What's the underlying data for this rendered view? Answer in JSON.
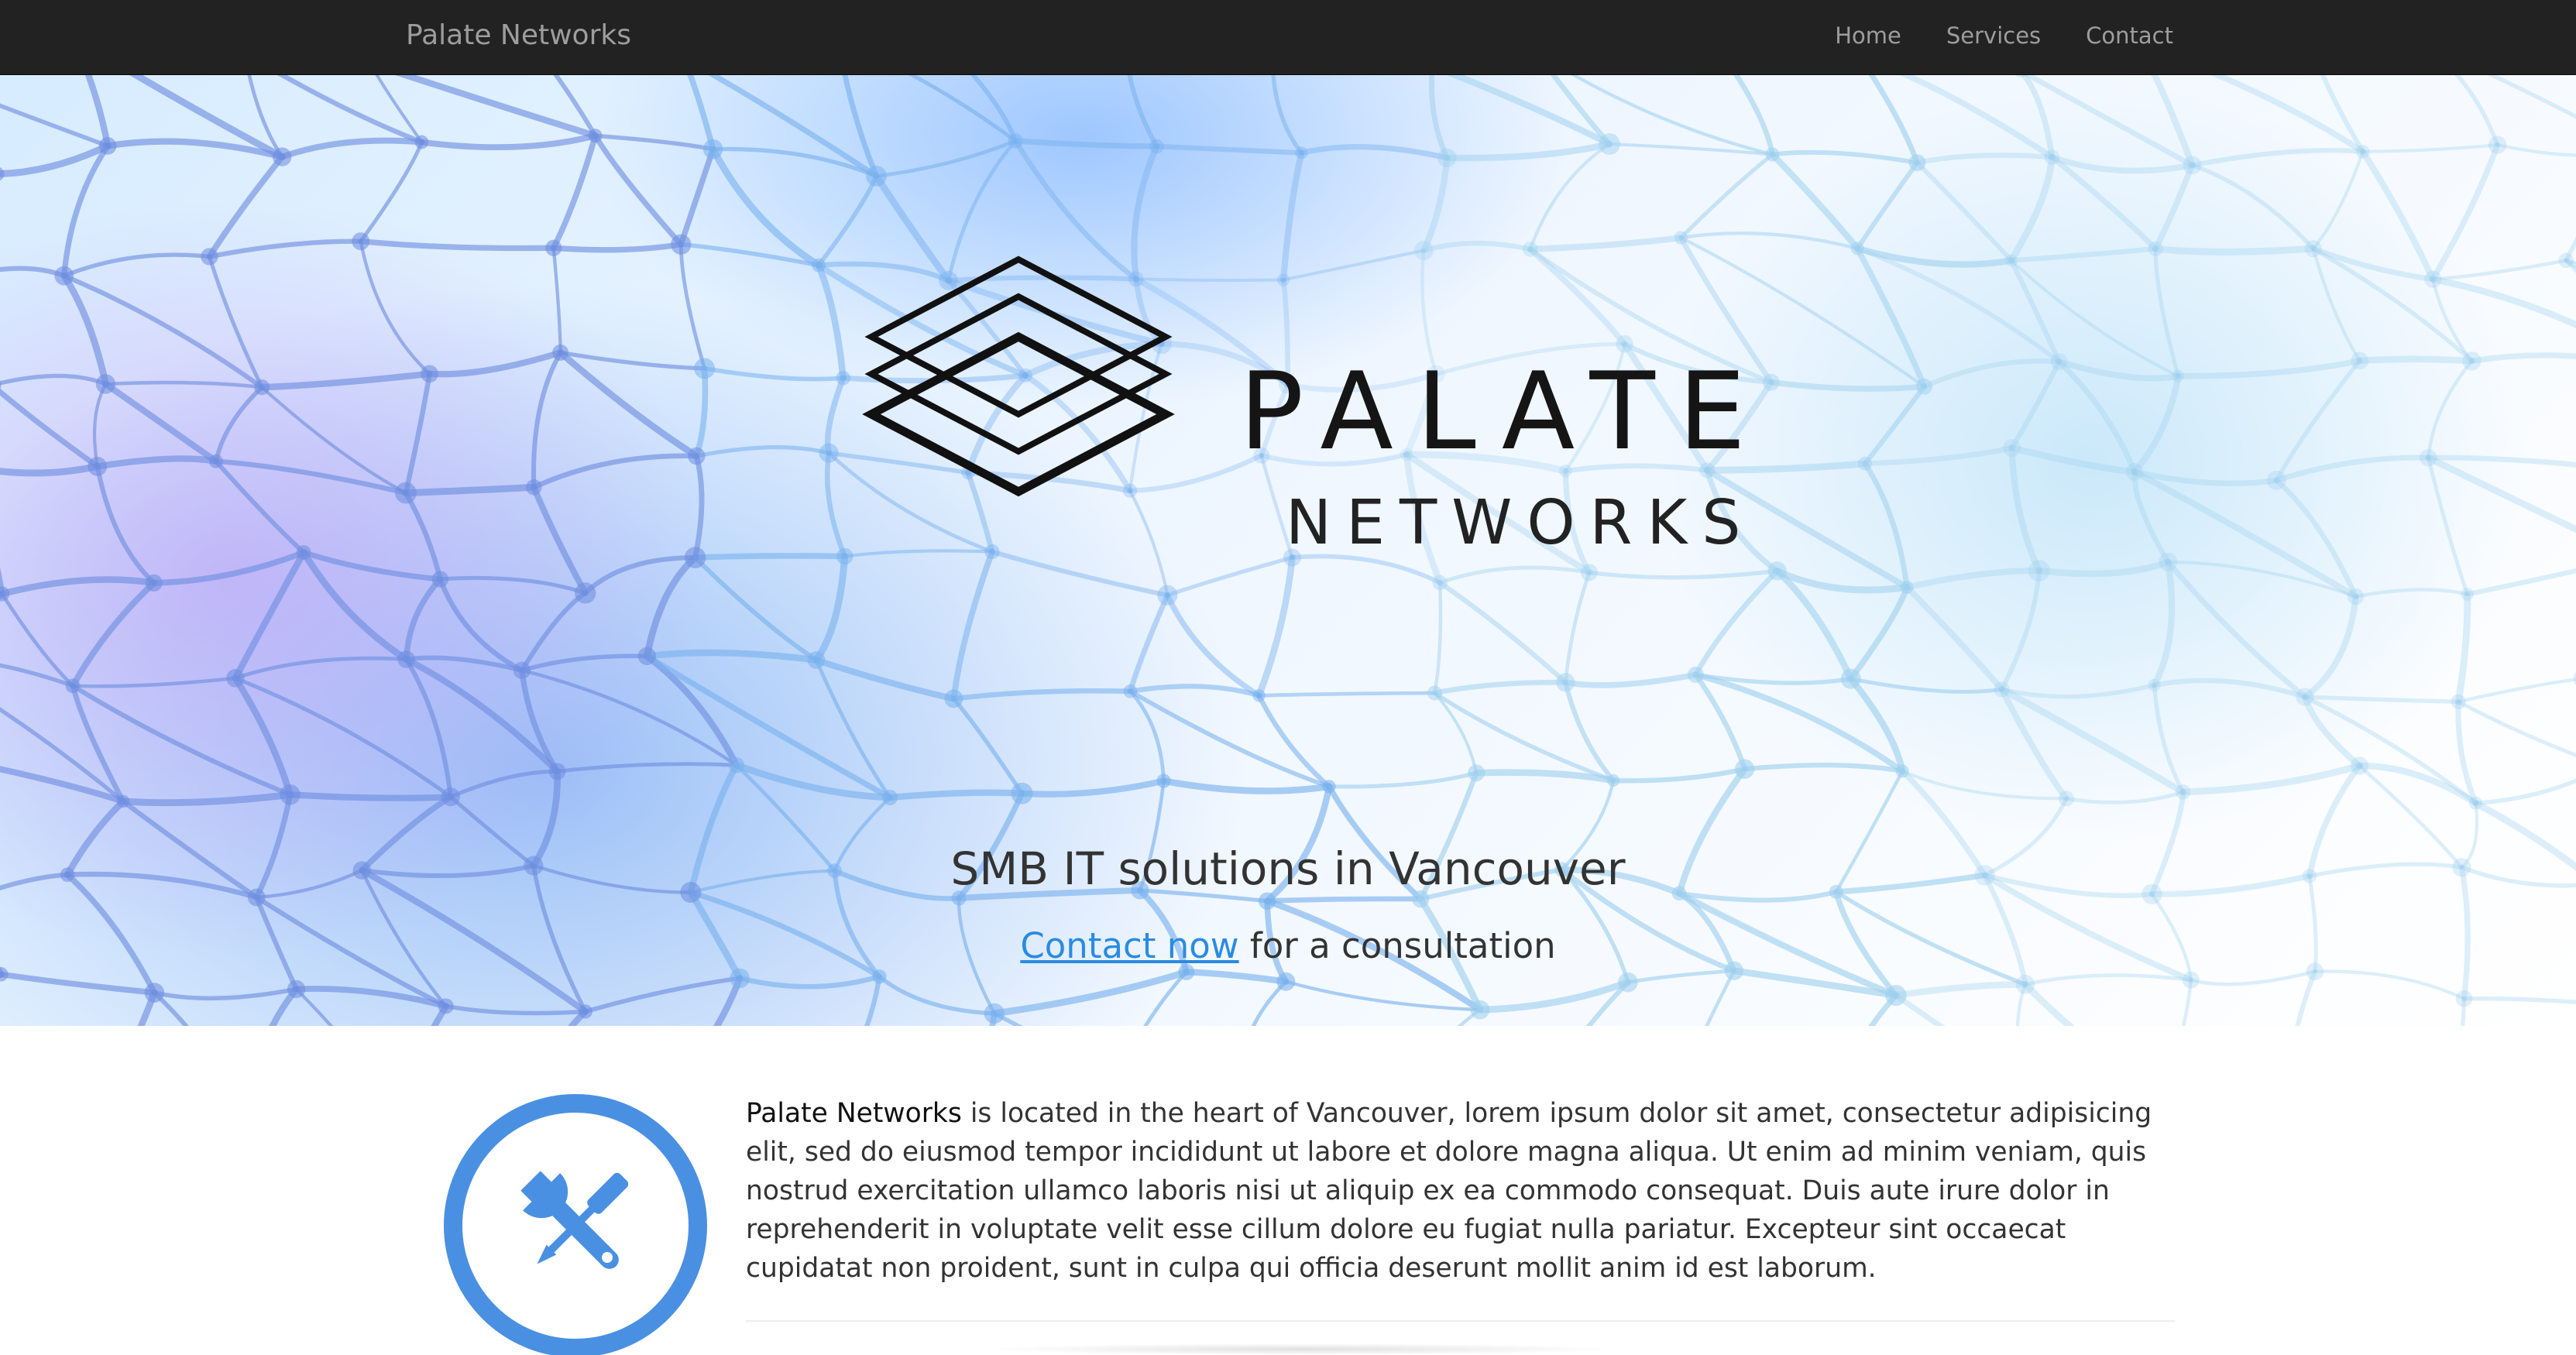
{
  "navbar": {
    "brand": "Palate Networks",
    "links": [
      {
        "label": "Home"
      },
      {
        "label": "Services"
      },
      {
        "label": "Contact"
      }
    ]
  },
  "hero": {
    "logo_word": "PALATE",
    "logo_sub": "NETWORKS",
    "tagline": "SMB IT solutions in Vancouver",
    "cta_link": "Contact now",
    "cta_rest": " for a consultation"
  },
  "about": {
    "strong": "Palate Networks",
    "body": " is located in the heart of Vancouver, lorem ipsum dolor sit amet, consectetur adipisicing elit, sed do eiusmod tempor incididunt ut labore et dolore magna aliqua. Ut enim ad minim veniam, quis nostrud exercitation ullamco laboris nisi ut aliquip ex ea commodo consequat. Duis aute irure dolor in reprehenderit in voluptate velit esse cillum dolore eu fugiat nulla pariatur. Excepteur sint occaecat cupidatat non proident, sunt in culpa qui officia deserunt mollit anim id est laborum."
  },
  "icons": {
    "feature": "tools-icon"
  },
  "colors": {
    "navbar_bg": "#222222",
    "nav_text": "#9d9d9d",
    "accent": "#4a90e2",
    "link": "#2a8be2"
  }
}
